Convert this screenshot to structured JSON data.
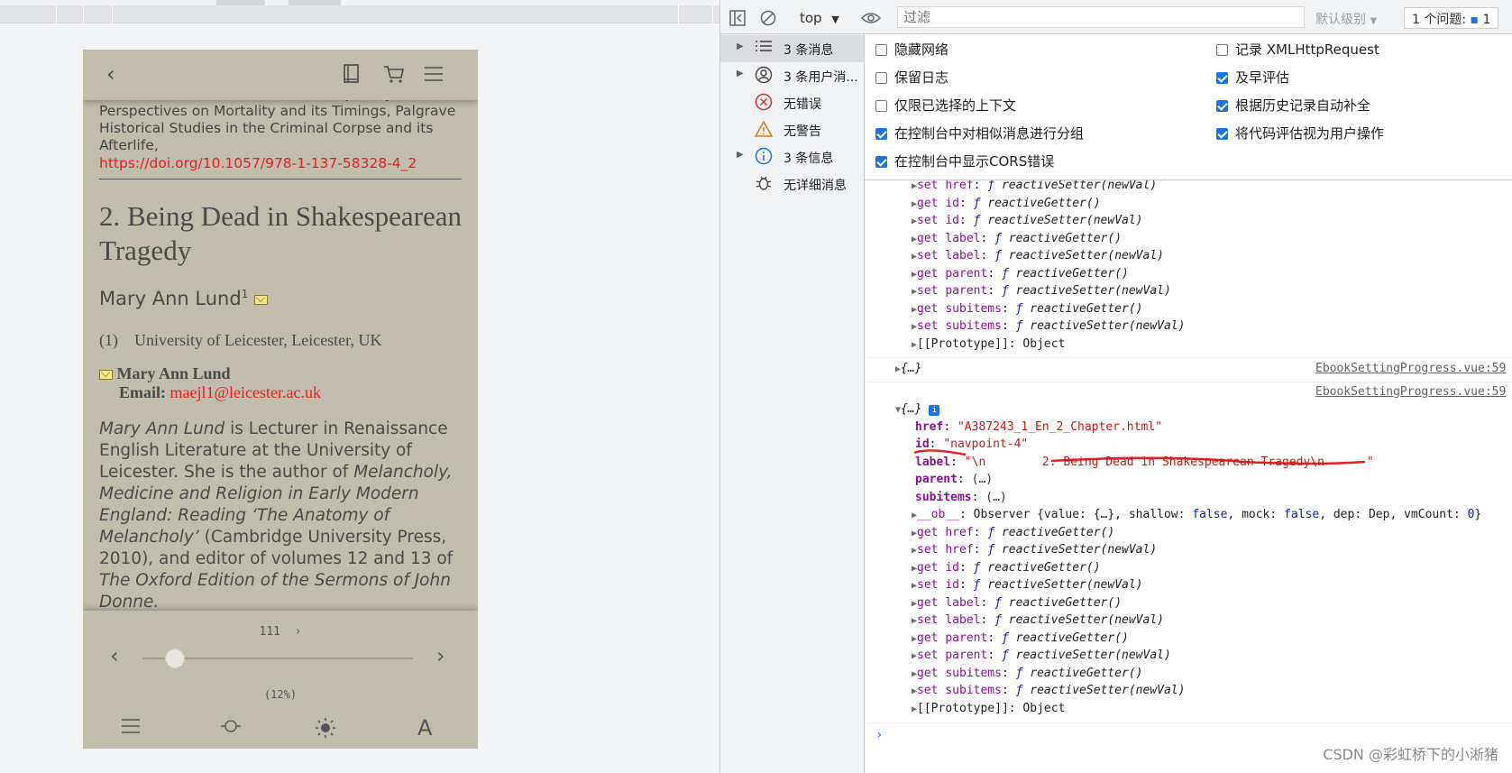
{
  "preview": {
    "prev_reference": "Shane McCorristine (ed.), Interdisciplinary Perspectives on Mortality and its Timings, Palgrave Historical Studies in the Criminal Corpse and its Afterlife,",
    "doi": "https://doi.org/10.1057/978-1-137-58328-4_2",
    "chapter_title": "2. Being Dead in Shakespearean Tragedy",
    "author_name": "Mary Ann Lund",
    "author_sup": "1",
    "affiliation_num": "(1)",
    "affiliation": "University of Leicester, Leicester, UK",
    "contact_name": "Mary Ann Lund",
    "email_label": "Email:",
    "email": "maejl1@leicester.ac.uk",
    "bio_parts": [
      {
        "t": "Mary Ann Lund",
        "i": true
      },
      {
        "t": " is Lecturer in Renaissance English Literature at the University of Leicester. She is the author of ",
        "i": false
      },
      {
        "t": "Melancholy, Medicine and Religion in Early Modern England: Reading ‘The Anatomy of Melancholy’",
        "i": true
      },
      {
        "t": " (Cambridge University Press, 2010), and editor of volumes 12 and 13 of ",
        "i": false
      },
      {
        "t": "The Oxford Edition of the Sermons of John Donne.",
        "i": true
      }
    ],
    "page_number": "111",
    "progress_text": "(12%)",
    "progress": 0.12,
    "icons": {
      "back": "chevron-left-icon",
      "book": "book-icon",
      "cart": "cart-icon",
      "menu": "menu-icon"
    }
  },
  "devtools": {
    "context": "top",
    "filter_placeholder": "过滤",
    "levels": "默认级别",
    "issues": "1 个问题:",
    "issues_count": "1",
    "sidebar": [
      {
        "label": "3 条消息",
        "icon": "list-icon",
        "expandable": true,
        "selected": true
      },
      {
        "label": "3 条用户消...",
        "icon": "user-icon",
        "expandable": true,
        "selected": false
      },
      {
        "label": "无错误",
        "icon": "error-icon",
        "expandable": false,
        "selected": false
      },
      {
        "label": "无警告",
        "icon": "warning-icon",
        "expandable": false,
        "selected": false
      },
      {
        "label": "3 条信息",
        "icon": "info-icon",
        "expandable": true,
        "selected": false
      },
      {
        "label": "无详细消息",
        "icon": "bug-icon",
        "expandable": false,
        "selected": false
      }
    ],
    "settings_left": [
      {
        "label": "隐藏网络",
        "checked": false
      },
      {
        "label": "保留日志",
        "checked": false
      },
      {
        "label": "仅限已选择的上下文",
        "checked": false
      },
      {
        "label": "在控制台中对相似消息进行分组",
        "checked": true
      },
      {
        "label": "在控制台中显示CORS错误",
        "checked": true
      }
    ],
    "settings_right": [
      {
        "label": "记录 XMLHttpRequest",
        "checked": false
      },
      {
        "label": "及早评估",
        "checked": true
      },
      {
        "label": "根据历史记录自动补全",
        "checked": true
      },
      {
        "label": "将代码评估视为用户操作",
        "checked": true
      }
    ],
    "console_top_lines": [
      [
        "set",
        "href",
        "reactiveSetter(newVal)"
      ],
      [
        "get",
        "id",
        "reactiveGetter()"
      ],
      [
        "set",
        "id",
        "reactiveSetter(newVal)"
      ],
      [
        "get",
        "label",
        "reactiveGetter()"
      ],
      [
        "set",
        "label",
        "reactiveSetter(newVal)"
      ],
      [
        "get",
        "parent",
        "reactiveGetter()"
      ],
      [
        "set",
        "parent",
        "reactiveSetter(newVal)"
      ],
      [
        "get",
        "subitems",
        "reactiveGetter()"
      ],
      [
        "set",
        "subitems",
        "reactiveSetter(newVal)"
      ]
    ],
    "prototype_line": "[[Prototype]]: Object",
    "collapsed_obj": "{…}",
    "source_link": "EbookSettingProgress.vue:59",
    "expanded_obj": "{…}",
    "props": {
      "href_key": "href",
      "href_val": "\"A387243_1_En_2_Chapter.html\"",
      "id_key": "id",
      "id_val": "\"navpoint-4\"",
      "label_key": "label",
      "label_val": "\"\\n        2. Being Dead in Shakespearean Tragedy\\n      \"",
      "parent_key": "parent",
      "parent_val": "(…)",
      "subitems_key": "subitems",
      "subitems_val": "(…)"
    },
    "ob_line": "__ob__: Observer {value: {…}, shallow: false, mock: false, dep: Dep, vmCount: 0}",
    "console_bottom_lines": [
      [
        "get",
        "href",
        "reactiveGetter()"
      ],
      [
        "set",
        "href",
        "reactiveSetter(newVal)"
      ],
      [
        "get",
        "id",
        "reactiveGetter()"
      ],
      [
        "set",
        "id",
        "reactiveSetter(newVal)"
      ],
      [
        "get",
        "label",
        "reactiveGetter()"
      ],
      [
        "set",
        "label",
        "reactiveSetter(newVal)"
      ],
      [
        "get",
        "parent",
        "reactiveGetter()"
      ],
      [
        "set",
        "parent",
        "reactiveSetter(newVal)"
      ],
      [
        "get",
        "subitems",
        "reactiveGetter()"
      ],
      [
        "set",
        "subitems",
        "reactiveSetter(newVal)"
      ]
    ],
    "watermark": "CSDN @彩虹桥下的小淅猪",
    "accent_color": "#1a73e8",
    "annotation_color": "#e8201f"
  }
}
